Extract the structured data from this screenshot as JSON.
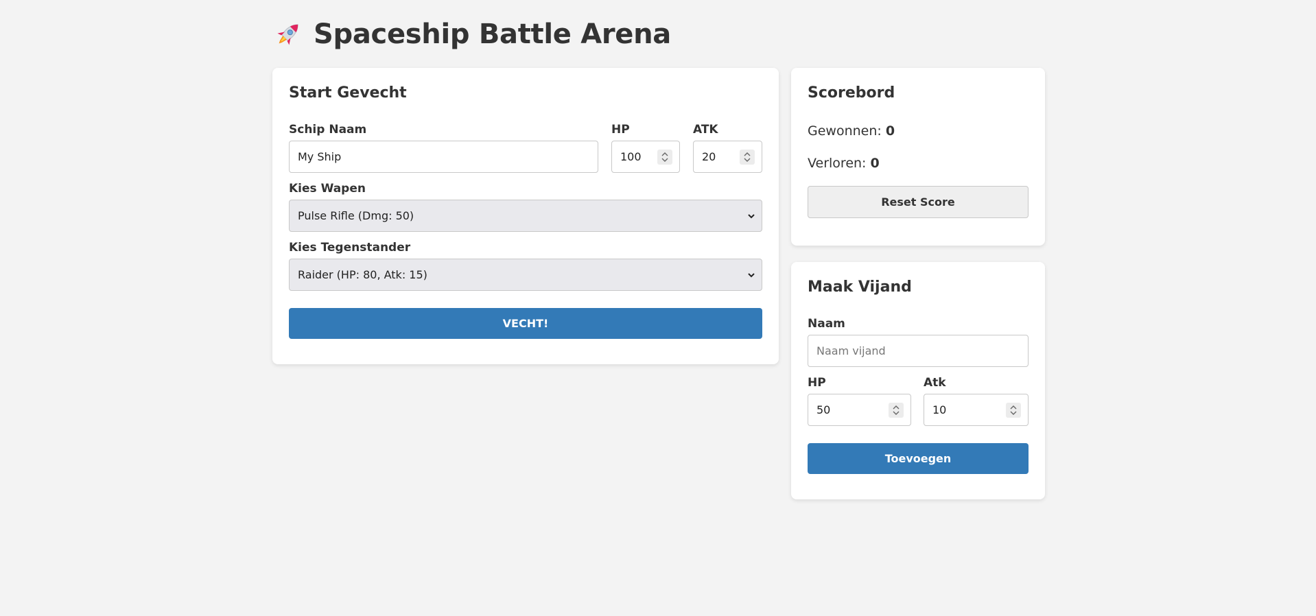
{
  "header": {
    "title": "Spaceship Battle Arena",
    "icon": "rocket-icon"
  },
  "battle": {
    "heading": "Start Gevecht",
    "ship_name_label": "Schip Naam",
    "ship_name_value": "My Ship",
    "hp_label": "HP",
    "hp_value": "100",
    "atk_label": "ATK",
    "atk_value": "20",
    "weapon_label": "Kies Wapen",
    "weapon_selected": "Pulse Rifle (Dmg: 50)",
    "opponent_label": "Kies Tegenstander",
    "opponent_selected": "Raider (HP: 80, Atk: 15)",
    "fight_button": "VECHT!"
  },
  "scoreboard": {
    "heading": "Scorebord",
    "won_label": "Gewonnen:",
    "won_value": "0",
    "lost_label": "Verloren:",
    "lost_value": "0",
    "reset_button": "Reset Score"
  },
  "enemy": {
    "heading": "Maak Vijand",
    "name_label": "Naam",
    "name_placeholder": "Naam vijand",
    "hp_label": "HP",
    "hp_value": "50",
    "atk_label": "Atk",
    "atk_value": "10",
    "add_button": "Toevoegen"
  },
  "colors": {
    "primary": "#337ab7",
    "background": "#f3f3f3",
    "card": "#ffffff"
  }
}
